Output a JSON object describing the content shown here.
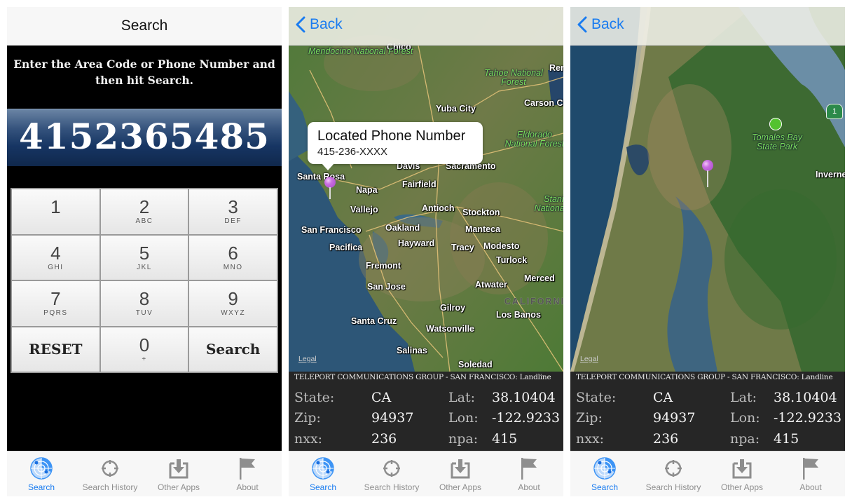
{
  "screens": [
    {
      "nav": {
        "title": "Search"
      },
      "instructions": "Enter the Area Code or Phone Number and then hit Search.",
      "display_value": "4152365485",
      "keypad": [
        {
          "digit": "1",
          "letters": ""
        },
        {
          "digit": "2",
          "letters": "ABC"
        },
        {
          "digit": "3",
          "letters": "DEF"
        },
        {
          "digit": "4",
          "letters": "GHI"
        },
        {
          "digit": "5",
          "letters": "JKL"
        },
        {
          "digit": "6",
          "letters": "MNO"
        },
        {
          "digit": "7",
          "letters": "PQRS"
        },
        {
          "digit": "8",
          "letters": "TUV"
        },
        {
          "digit": "9",
          "letters": "WXYZ"
        },
        {
          "word": "RESET"
        },
        {
          "digit": "0",
          "letters": "+"
        },
        {
          "word": "Search"
        }
      ]
    },
    {
      "nav": {
        "back_label": "Back"
      },
      "callout": {
        "title": "Located Phone Number",
        "subtitle": "415-236-XXXX"
      },
      "map_labels": [
        "Chico",
        "Mendocino National Forest",
        "Tahoe National Forest",
        "Reno",
        "Yuba City",
        "Carson City",
        "Eldorado National Forest",
        "Davis",
        "Sacramento",
        "Santa Rosa",
        "Napa",
        "Fairfield",
        "Vallejo",
        "Antioch",
        "Stockton",
        "Stanislaus National Forest",
        "San Francisco",
        "Oakland",
        "Manteca",
        "Pacifica",
        "Hayward",
        "Tracy",
        "Modesto",
        "Fremont",
        "Turlock",
        "San Jose",
        "Atwater",
        "Merced",
        "CALIFORNIA",
        "Gilroy",
        "Los Banos",
        "Santa Cruz",
        "Watsonville",
        "Salinas",
        "Soledad"
      ],
      "legal": "Legal"
    },
    {
      "nav": {
        "back_label": "Back"
      },
      "map_labels": [
        "Tomales Bay State Park",
        "Inverness",
        "1"
      ],
      "legal": "Legal"
    }
  ],
  "info": {
    "carrier": "TELEPORT COMMUNICATIONS GROUP - SAN FRANCISCO: Landline",
    "state_label": "State:",
    "state": "CA",
    "lat_label": "Lat:",
    "lat": "38.10404",
    "zip_label": "Zip:",
    "zip": "94937",
    "lon_label": "Lon:",
    "lon": "-122.9233",
    "nxx_label": "nxx:",
    "nxx": "236",
    "npa_label": "npa:",
    "npa": "415"
  },
  "tabs": [
    {
      "label": "Search",
      "icon": "radar-icon",
      "active": true
    },
    {
      "label": "Search History",
      "icon": "crosshair-icon"
    },
    {
      "label": "Other Apps",
      "icon": "download-tray-icon"
    },
    {
      "label": "About",
      "icon": "flag-icon"
    }
  ],
  "colors": {
    "accent": "#1a7cf0",
    "display_blue": "#163563",
    "info_bg": "#262626",
    "pin": "#c96ee0"
  }
}
